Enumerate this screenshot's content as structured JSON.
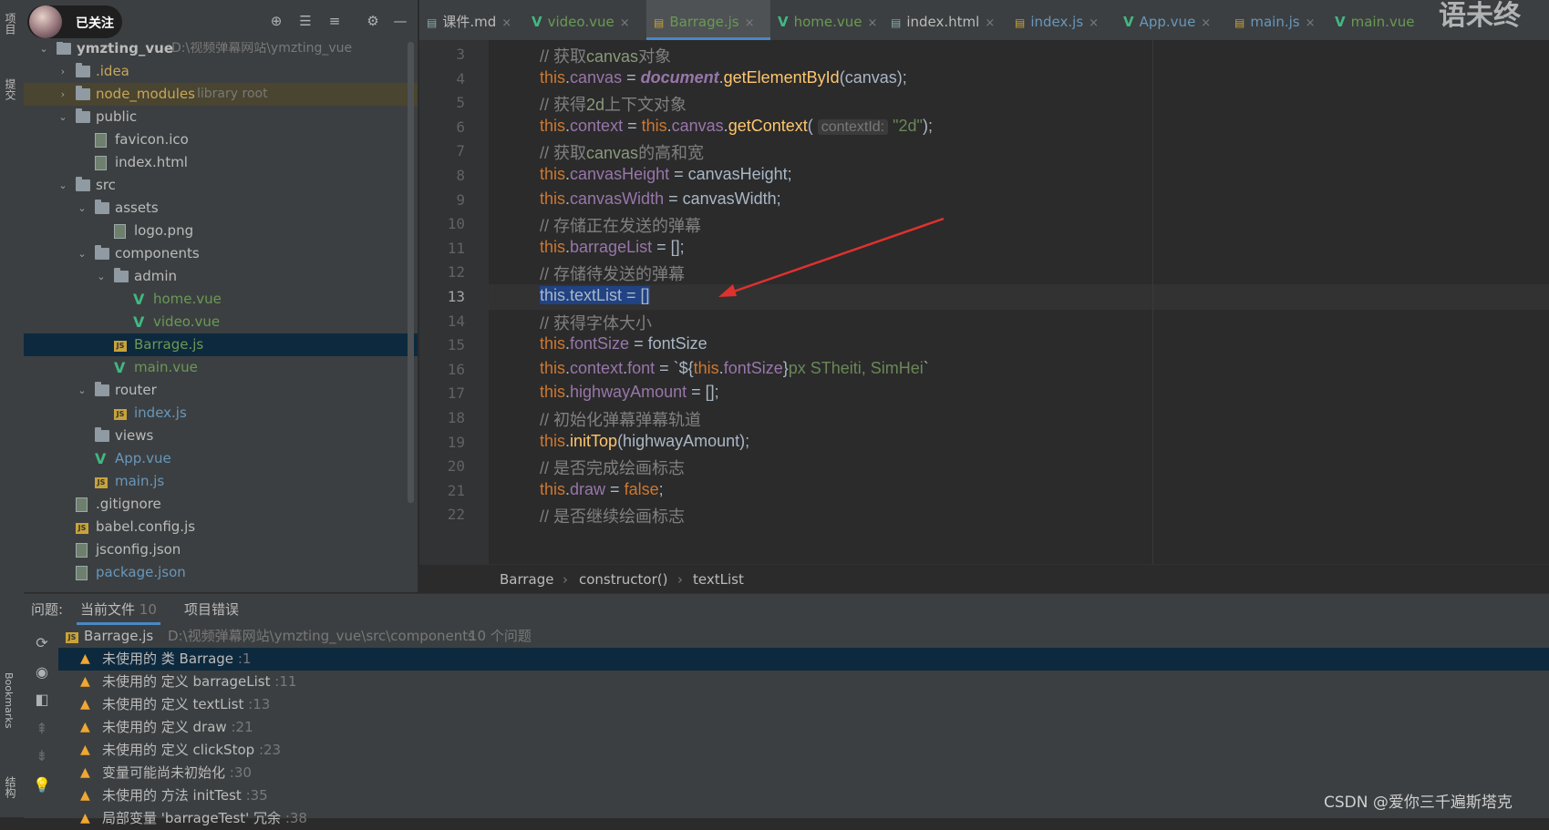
{
  "left_strip": {
    "project_label": "项目",
    "commit_label": "提交",
    "bookmarks_label": "Bookmarks",
    "structure_label": "结构"
  },
  "overlay": {
    "follow_label": "已关注"
  },
  "project_tree": [
    {
      "label": "ymzting_vue",
      "path": "D:\\视频弹幕网站\\ymzting_vue",
      "type": "folder",
      "depth": 0,
      "expanded": true
    },
    {
      "label": ".idea",
      "type": "folder",
      "depth": 1,
      "expanded": false,
      "color": "#c7a65a"
    },
    {
      "label": "node_modules",
      "suffix": "library root",
      "type": "folder",
      "depth": 1,
      "expanded": false,
      "color": "#c7a65a"
    },
    {
      "label": "public",
      "type": "folder",
      "depth": 1,
      "expanded": true
    },
    {
      "label": "favicon.ico",
      "type": "file",
      "depth": 2
    },
    {
      "label": "index.html",
      "type": "file",
      "depth": 2
    },
    {
      "label": "src",
      "type": "folder",
      "depth": 1,
      "expanded": true
    },
    {
      "label": "assets",
      "type": "folder",
      "depth": 2,
      "expanded": true
    },
    {
      "label": "logo.png",
      "type": "file",
      "depth": 3
    },
    {
      "label": "components",
      "type": "folder",
      "depth": 2,
      "expanded": true
    },
    {
      "label": "admin",
      "type": "folder",
      "depth": 3,
      "expanded": true
    },
    {
      "label": "home.vue",
      "type": "vue",
      "depth": 4,
      "color": "#6a9955"
    },
    {
      "label": "video.vue",
      "type": "vue",
      "depth": 4,
      "color": "#6a9955"
    },
    {
      "label": "Barrage.js",
      "type": "js",
      "depth": 3,
      "color": "#6a9955",
      "selected": true
    },
    {
      "label": "main.vue",
      "type": "vue",
      "depth": 3,
      "color": "#6a9955"
    },
    {
      "label": "router",
      "type": "folder",
      "depth": 2,
      "expanded": true
    },
    {
      "label": "index.js",
      "type": "js",
      "depth": 3,
      "color": "#6897bb"
    },
    {
      "label": "views",
      "type": "folder",
      "depth": 2
    },
    {
      "label": "App.vue",
      "type": "vue",
      "depth": 2,
      "color": "#6897bb"
    },
    {
      "label": "main.js",
      "type": "js",
      "depth": 2,
      "color": "#6897bb"
    },
    {
      "label": ".gitignore",
      "type": "file",
      "depth": 1
    },
    {
      "label": "babel.config.js",
      "type": "js",
      "depth": 1
    },
    {
      "label": "jsconfig.json",
      "type": "file",
      "depth": 1
    },
    {
      "label": "package.json",
      "type": "file",
      "depth": 1,
      "color": "#6897bb"
    }
  ],
  "tabs": [
    {
      "label": "课件.md",
      "color": "#bbbbbb",
      "icon": "markdown-icon"
    },
    {
      "label": "video.vue",
      "color": "#6a9955",
      "icon": "vue-icon"
    },
    {
      "label": "Barrage.js",
      "color": "#6a9955",
      "icon": "js-icon",
      "active": true
    },
    {
      "label": "home.vue",
      "color": "#6a9955",
      "icon": "vue-icon"
    },
    {
      "label": "index.html",
      "color": "#bbbbbb",
      "icon": "html-icon"
    },
    {
      "label": "index.js",
      "color": "#6897bb",
      "icon": "js-icon"
    },
    {
      "label": "App.vue",
      "color": "#6897bb",
      "icon": "vue-icon"
    },
    {
      "label": "main.js",
      "color": "#6897bb",
      "icon": "js-icon"
    },
    {
      "label": "main.vue",
      "color": "#6a9955",
      "icon": "vue-icon"
    }
  ],
  "editor": {
    "current_line": 13,
    "lines": [
      {
        "n": "3",
        "segs": [
          [
            "cmt",
            "// 获取"
          ],
          [
            "cmt2",
            "canvas"
          ],
          [
            "cmt",
            "对象"
          ]
        ]
      },
      {
        "n": "4",
        "segs": [
          [
            "kw",
            "this"
          ],
          [
            "p",
            "."
          ],
          [
            "prop",
            "canvas"
          ],
          [
            "p",
            " = "
          ],
          [
            "doc",
            "document"
          ],
          [
            "p",
            "."
          ],
          [
            "fn",
            "getElementById"
          ],
          [
            "p",
            "(canvas);"
          ]
        ]
      },
      {
        "n": "5",
        "segs": [
          [
            "cmt",
            "// 获得"
          ],
          [
            "cmt2",
            "2d"
          ],
          [
            "cmt",
            "上下文对象"
          ]
        ]
      },
      {
        "n": "6",
        "segs": [
          [
            "kw",
            "this"
          ],
          [
            "p",
            "."
          ],
          [
            "prop",
            "context"
          ],
          [
            "p",
            " = "
          ],
          [
            "kw",
            "this"
          ],
          [
            "p",
            "."
          ],
          [
            "prop",
            "canvas"
          ],
          [
            "p",
            "."
          ],
          [
            "fn",
            "getContext"
          ],
          [
            "p",
            "( "
          ],
          [
            "hint",
            "contextId:"
          ],
          [
            "p",
            " "
          ],
          [
            "str",
            "\"2d\""
          ],
          [
            "p",
            ");"
          ]
        ]
      },
      {
        "n": "7",
        "segs": [
          [
            "cmt",
            "// 获取"
          ],
          [
            "cmt2",
            "canvas"
          ],
          [
            "cmt",
            "的高和宽"
          ]
        ]
      },
      {
        "n": "8",
        "segs": [
          [
            "kw",
            "this"
          ],
          [
            "p",
            "."
          ],
          [
            "prop",
            "canvasHeight"
          ],
          [
            "p",
            " = canvasHeight;"
          ]
        ]
      },
      {
        "n": "9",
        "segs": [
          [
            "kw",
            "this"
          ],
          [
            "p",
            "."
          ],
          [
            "prop",
            "canvasWidth"
          ],
          [
            "p",
            " = canvasWidth;"
          ]
        ]
      },
      {
        "n": "10",
        "segs": [
          [
            "cmt",
            "// 存储正在发送的弹幕"
          ]
        ]
      },
      {
        "n": "11",
        "segs": [
          [
            "kw",
            "this"
          ],
          [
            "p",
            "."
          ],
          [
            "prop",
            "barrageList"
          ],
          [
            "p",
            " = [];"
          ]
        ]
      },
      {
        "n": "12",
        "segs": [
          [
            "cmt",
            "// 存储待发送的弹幕"
          ]
        ]
      },
      {
        "n": "13",
        "segs": [
          [
            "sel",
            "this.textList = []"
          ]
        ]
      },
      {
        "n": "14",
        "segs": [
          [
            "cmt",
            "// 获得字体大小"
          ]
        ]
      },
      {
        "n": "15",
        "segs": [
          [
            "kw",
            "this"
          ],
          [
            "p",
            "."
          ],
          [
            "prop",
            "fontSize"
          ],
          [
            "p",
            " = fontSize"
          ]
        ]
      },
      {
        "n": "16",
        "segs": [
          [
            "kw",
            "this"
          ],
          [
            "p",
            "."
          ],
          [
            "prop",
            "context"
          ],
          [
            "p",
            "."
          ],
          [
            "prop",
            "font"
          ],
          [
            "p",
            " = `${"
          ],
          [
            "kw",
            "this"
          ],
          [
            "p",
            "."
          ],
          [
            "prop",
            "fontSize"
          ],
          [
            "p",
            "}"
          ],
          [
            "str",
            "px STheiti, SimHei"
          ],
          [
            "p",
            "`"
          ]
        ]
      },
      {
        "n": "17",
        "segs": [
          [
            "kw",
            "this"
          ],
          [
            "p",
            "."
          ],
          [
            "prop",
            "highwayAmount"
          ],
          [
            "p",
            " = [];"
          ]
        ]
      },
      {
        "n": "18",
        "segs": [
          [
            "cmt",
            "// 初始化弹幕弹幕轨道"
          ]
        ]
      },
      {
        "n": "19",
        "segs": [
          [
            "kw",
            "this"
          ],
          [
            "p",
            "."
          ],
          [
            "fn",
            "initTop"
          ],
          [
            "p",
            "(highwayAmount);"
          ]
        ]
      },
      {
        "n": "20",
        "segs": [
          [
            "cmt",
            "// 是否完成绘画标志"
          ]
        ]
      },
      {
        "n": "21",
        "segs": [
          [
            "kw",
            "this"
          ],
          [
            "p",
            "."
          ],
          [
            "prop",
            "draw"
          ],
          [
            "p",
            " = "
          ],
          [
            "kw",
            "false"
          ],
          [
            "p",
            ";"
          ]
        ]
      },
      {
        "n": "22",
        "segs": [
          [
            "cmt",
            "// 是否继续绘画标志"
          ]
        ]
      }
    ]
  },
  "breadcrumb": [
    "Barrage",
    "constructor()",
    "textList"
  ],
  "problems": {
    "label": "问题:",
    "tabs": [
      {
        "label": "当前文件",
        "count": "10",
        "active": true
      },
      {
        "label": "项目错误",
        "count": ""
      }
    ],
    "file": {
      "name": "Barrage.js",
      "path": "D:\\视频弹幕网站\\ymzting_vue\\src\\components",
      "count": "10 个问题"
    },
    "items": [
      {
        "text": "未使用的 类 Barrage",
        "line": ":1",
        "selected": true
      },
      {
        "text": "未使用的 定义 barrageList",
        "line": ":11"
      },
      {
        "text": "未使用的 定义 textList",
        "line": ":13"
      },
      {
        "text": "未使用的 定义 draw",
        "line": ":21"
      },
      {
        "text": "未使用的 定义 clickStop",
        "line": ":23"
      },
      {
        "text": "变量可能尚未初始化",
        "line": ":30"
      },
      {
        "text": "未使用的 方法 initTest",
        "line": ":35"
      },
      {
        "text": "局部变量 'barrageTest' 冗余",
        "line": ":38"
      }
    ]
  },
  "watermarks": {
    "top_right": "语未终",
    "bottom_right": "CSDN @爱你三千遍斯塔克"
  }
}
